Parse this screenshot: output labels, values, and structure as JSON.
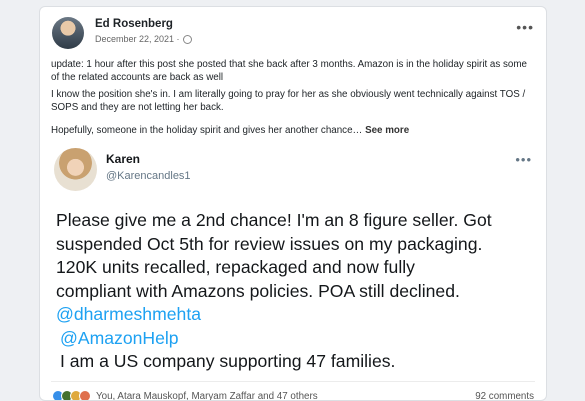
{
  "post": {
    "author": "Ed Rosenberg",
    "date": "December 22, 2021 ·",
    "more_icon": "•••",
    "paragraphs": [
      "update: 1 hour after this post she posted that she back after 3 months. Amazon is in the holiday spirit as some of the related accounts are back as well",
      "I know the position she's in. I am literally going to pray for her as she obviously went technically against TOS / SOPS and they are not letting her back.",
      "Hopefully, someone in the holiday spirit and gives her another chance…"
    ],
    "see_more": "See more"
  },
  "tweet": {
    "name": "Karen",
    "handle": "@Karencandles1",
    "more_icon": "•••",
    "lines": [
      "Please give me a 2nd chance! I'm an 8 figure seller. Got",
      "suspended Oct 5th for review issues on my packaging.",
      "120K units recalled, repackaged and now fully",
      "compliant with Amazons policies. POA still declined."
    ],
    "mentions": [
      "@dharmeshmehta",
      "@AmazonHelp"
    ],
    "last_line": "I am a US company supporting 47 families."
  },
  "footer": {
    "reactions_text": "You, Atara Mauskopf, Maryam Zaffar and 47 others",
    "comments": "92 comments",
    "reaction_icons": [
      "like-icon",
      "celebrate-icon",
      "support-icon",
      "love-icon"
    ],
    "colors": {
      "like": "#378fe9",
      "celebrate": "#44712e",
      "support": "#dfaa3d",
      "love": "#df704d"
    }
  }
}
